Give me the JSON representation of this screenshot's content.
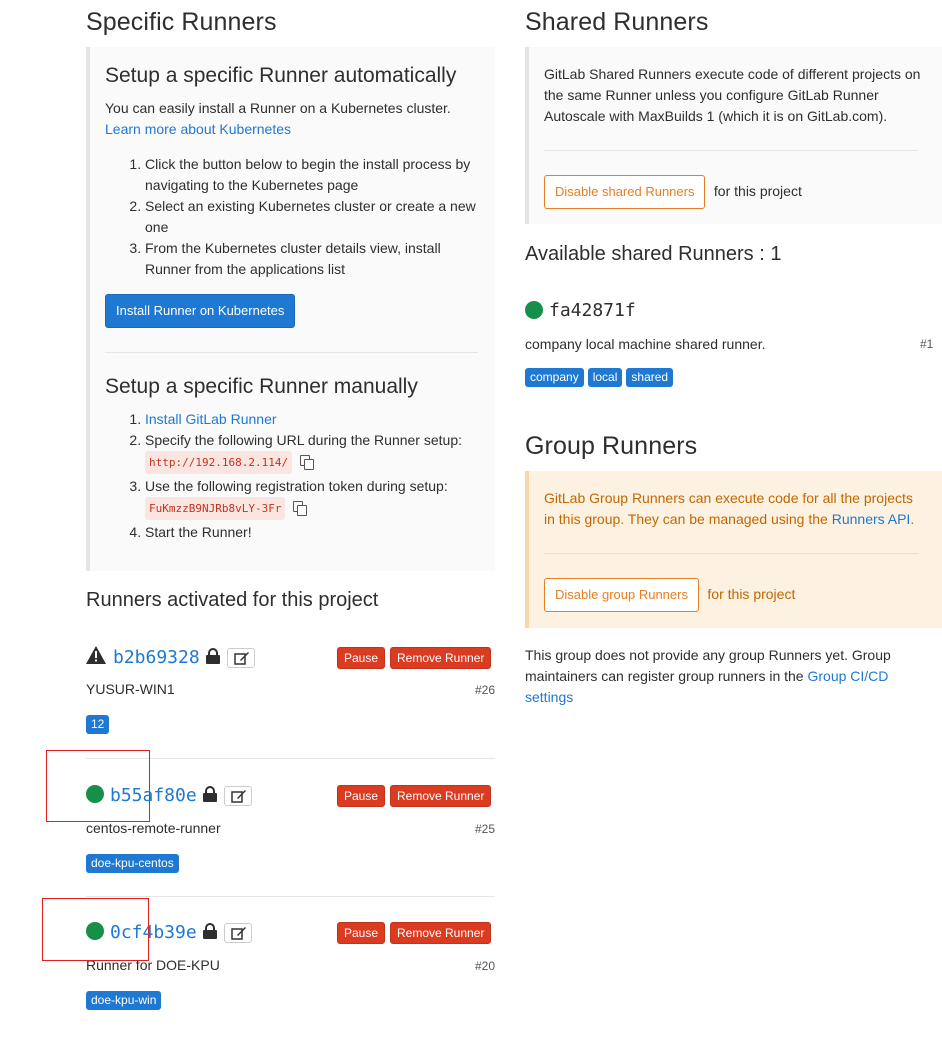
{
  "specific": {
    "title": "Specific Runners",
    "auto": {
      "title": "Setup a specific Runner automatically",
      "desc": "You can easily install a Runner on a Kubernetes cluster.",
      "link": "Learn more about Kubernetes",
      "steps": [
        "Click the button below to begin the install process by navigating to the Kubernetes page",
        "Select an existing Kubernetes cluster or create a new one",
        "From the Kubernetes cluster details view, install Runner from the applications list"
      ],
      "install_button": "Install Runner on Kubernetes"
    },
    "manual": {
      "title": "Setup a specific Runner manually",
      "step1_link": "Install GitLab Runner",
      "step2": "Specify the following URL during the Runner setup:",
      "url": "http://192.168.2.114/",
      "step3": "Use the following registration token during setup:",
      "token": "FuKmzzB9NJRb8vLY-3Fr",
      "step4": "Start the Runner!"
    },
    "activated_title": "Runners activated for this project",
    "pause_label": "Pause",
    "remove_label": "Remove Runner",
    "runners": [
      {
        "id": "b2b69328",
        "desc": "YUSUR-WIN1",
        "num": "#26",
        "tags": [
          "12"
        ],
        "status": "warning"
      },
      {
        "id": "b55af80e",
        "desc": "centos-remote-runner",
        "num": "#25",
        "tags": [
          "doe-kpu-centos"
        ],
        "status": "online"
      },
      {
        "id": "0cf4b39e",
        "desc": "Runner for DOE-KPU",
        "num": "#20",
        "tags": [
          "doe-kpu-win"
        ],
        "status": "online"
      }
    ]
  },
  "shared": {
    "title": "Shared Runners",
    "info": "GitLab Shared Runners execute code of different projects on the same Runner unless you configure GitLab Runner Autoscale with MaxBuilds 1 (which it is on GitLab.com).",
    "disable_button": "Disable shared Runners",
    "for_project": "for this project",
    "available_title": "Available shared Runners : 1",
    "runner": {
      "id": "fa42871f",
      "desc": "company local machine shared runner.",
      "num": "#1",
      "tags": [
        "company",
        "local",
        "shared"
      ]
    }
  },
  "group": {
    "title": "Group Runners",
    "info_before": "GitLab Group Runners can execute code for all the projects in this group. They can be managed using the ",
    "info_link": "Runners API",
    "info_after": ".",
    "disable_button": "Disable group Runners",
    "for_project": "for this project",
    "note_before": "This group does not provide any group Runners yet. Group maintainers can register group runners in the ",
    "note_link": "Group CI/CD settings"
  }
}
